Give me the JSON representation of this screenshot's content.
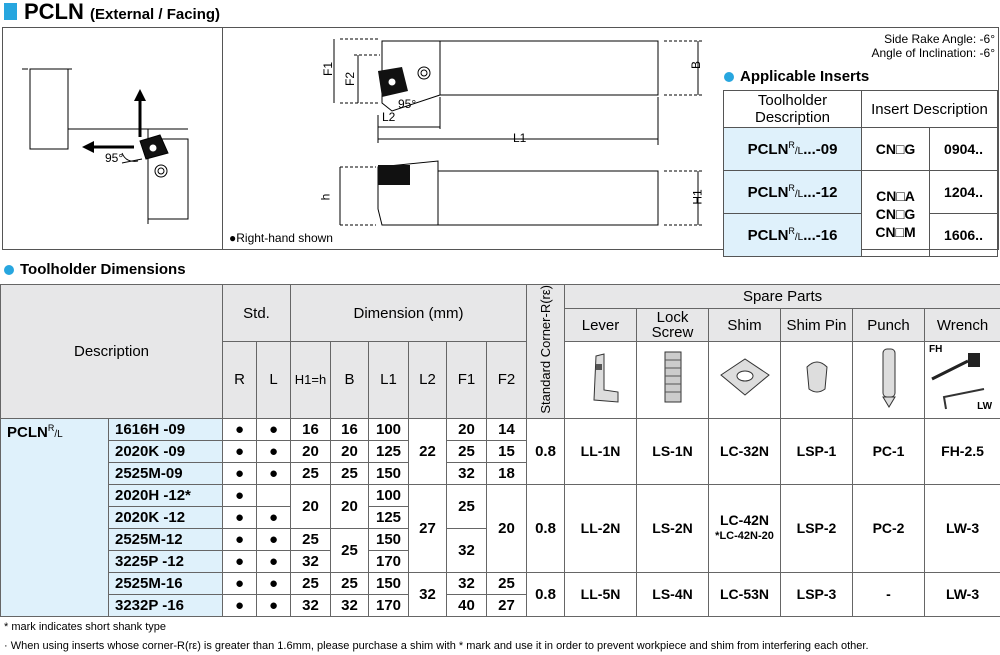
{
  "header": {
    "title": "PCLN",
    "subtitle": "(External / Facing)"
  },
  "diagram": {
    "side_rake": "Side Rake Angle: -6°",
    "inclination": "Angle of Inclination: -6°",
    "right_hand_note": "●Right-hand shown",
    "angle_left": "95°",
    "angle_top": "95°",
    "labels": {
      "F1": "F1",
      "F2": "F2",
      "L2": "L2",
      "L1": "L1",
      "B": "B",
      "h": "h",
      "H1": "H1"
    }
  },
  "inserts": {
    "heading": "Applicable Inserts",
    "col_holder": "Toolholder Description",
    "col_insert": "Insert Description",
    "rows": [
      {
        "holder_main": "PCLN",
        "holder_sup": "R",
        "holder_sub": "/L",
        "holder_tail": "...-09",
        "types": "CN□G",
        "code": "0904.."
      },
      {
        "holder_main": "PCLN",
        "holder_sup": "R",
        "holder_sub": "/L",
        "holder_tail": "...-12",
        "types_a": "CN□A",
        "types_b": "CN□G",
        "types_c": "CN□M",
        "code": "1204.."
      },
      {
        "holder_main": "PCLN",
        "holder_sup": "R",
        "holder_sub": "/L",
        "holder_tail": "...-16",
        "code": "1606.."
      }
    ]
  },
  "dims": {
    "heading": "Toolholder Dimensions",
    "h_description": "Description",
    "h_std": "Std.",
    "h_dimension": "Dimension (mm)",
    "h_corner": "Standard Corner-R(rε)",
    "h_spare": "Spare Parts",
    "h_R": "R",
    "h_L": "L",
    "h_H1h": "H1=h",
    "h_B": "B",
    "h_L1": "L1",
    "h_L2": "L2",
    "h_F1": "F1",
    "h_F2": "F2",
    "h_lever": "Lever",
    "h_lock1": "Lock",
    "h_lock2": "Screw",
    "h_shim": "Shim",
    "h_shimpin": "Shim Pin",
    "h_punch": "Punch",
    "h_wrench": "Wrench",
    "wrench_fh": "FH",
    "wrench_lw": "LW",
    "desc_main": "PCLN",
    "desc_sup": "R",
    "desc_sub": "/L",
    "bullet": "●",
    "rows": [
      {
        "code": "1616H -09",
        "h": "16",
        "b": "16",
        "l1": "100",
        "f1": "20",
        "f2": "14"
      },
      {
        "code": "2020K -09",
        "h": "20",
        "b": "20",
        "l1": "125",
        "f1": "25",
        "f2": "15"
      },
      {
        "code": "2525M-09",
        "h": "25",
        "b": "25",
        "l1": "150",
        "f1": "32",
        "f2": "18"
      },
      {
        "code": "2020H -12*",
        "l1": "100"
      },
      {
        "code": "2020K -12",
        "l1": "125"
      },
      {
        "code": "2525M-12",
        "h": "25",
        "l1": "150"
      },
      {
        "code": "3225P -12",
        "h": "32",
        "l1": "170"
      },
      {
        "code": "2525M-16",
        "h": "25",
        "b": "25",
        "l1": "150",
        "f1": "32",
        "f2": "25"
      },
      {
        "code": "3232P -16",
        "h": "32",
        "b": "32",
        "l1": "170",
        "f1": "40",
        "f2": "27"
      }
    ],
    "g1": {
      "l2": "22",
      "corner": "0.8",
      "lever": "LL-1N",
      "lock": "LS-1N",
      "shim": "LC-32N",
      "pin": "LSP-1",
      "punch": "PC-1",
      "wrench": "FH-2.5"
    },
    "g2": {
      "hb": "20",
      "b": "20",
      "l2": "27",
      "f1a": "25",
      "f1b": "32",
      "b2": "25",
      "f2": "20",
      "corner": "0.8",
      "lever": "LL-2N",
      "lock": "LS-2N",
      "shim": "LC-42N",
      "shim2": "*LC-42N-20",
      "pin": "LSP-2",
      "punch": "PC-2",
      "wrench": "LW-3"
    },
    "g3": {
      "l2": "32",
      "corner": "0.8",
      "lever": "LL-5N",
      "lock": "LS-4N",
      "shim": "LC-53N",
      "pin": "LSP-3",
      "punch": "-",
      "wrench": "LW-3"
    }
  },
  "notes": {
    "n1": "* mark indicates short shank type",
    "n2": "· When using inserts whose corner-R(rε) is greater than 1.6mm, please purchase a shim with * mark and use it in order to prevent workpiece and shim from interfering each other."
  }
}
